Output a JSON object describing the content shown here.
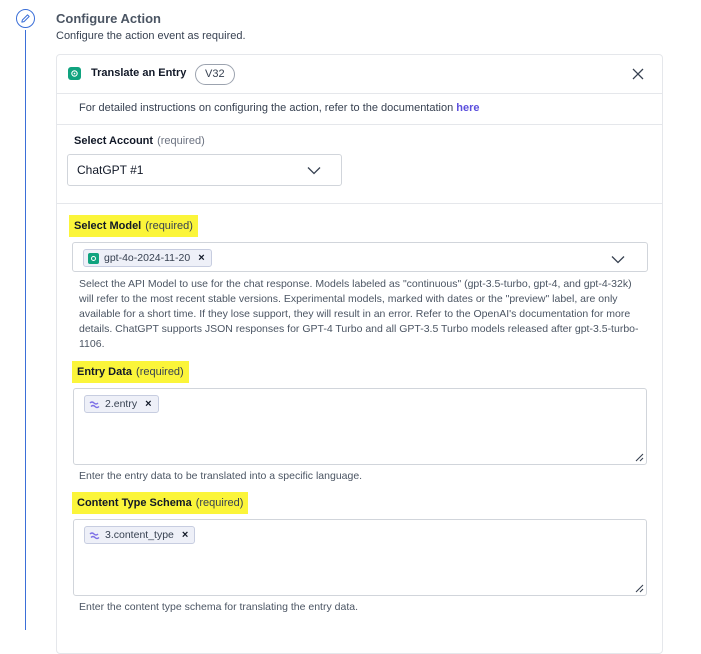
{
  "section": {
    "title": "Configure Action",
    "subtitle": "Configure the action event as required."
  },
  "card": {
    "title": "Translate an Entry",
    "version": "V32",
    "doc_note": "For detailed instructions on configuring the action, refer to the documentation ",
    "doc_link": "here"
  },
  "account": {
    "label": "Select Account",
    "required": "(required)",
    "value": "ChatGPT #1"
  },
  "model": {
    "label": "Select Model",
    "required": "(required)",
    "tag": "gpt-4o-2024-11-20",
    "help": "Select the API Model to use for the chat response. Models labeled as \"continuous\" (gpt-3.5-turbo, gpt-4, and gpt-4-32k) will refer to the most recent stable versions. Experimental models, marked with dates or the \"preview\" label, are only available for a short time. If they lose support, they will result in an error. Refer to the OpenAI's documentation for more details. ChatGPT supports JSON responses for GPT-4 Turbo and all GPT-3.5 Turbo models released after gpt-3.5-turbo-1106."
  },
  "entry_data": {
    "label": "Entry Data",
    "required": "(required)",
    "tag": "2.entry",
    "help": "Enter the entry data to be translated into a specific language."
  },
  "content_type_schema": {
    "label": "Content Type Schema",
    "required": "(required)",
    "tag": "3.content_type",
    "help": "Enter the content type schema for translating the entry data."
  },
  "icons": {
    "step": "pencil-icon",
    "app": "openai-icon",
    "close": "close-icon",
    "chevron": "chevron-down-icon",
    "variable": "link-variable-icon",
    "resize": "resize-handle-icon"
  },
  "colors": {
    "accent": "#3b6fd8",
    "highlight": "#fbf53a",
    "link": "#5b4fdd",
    "openai_green": "#10a37f"
  }
}
